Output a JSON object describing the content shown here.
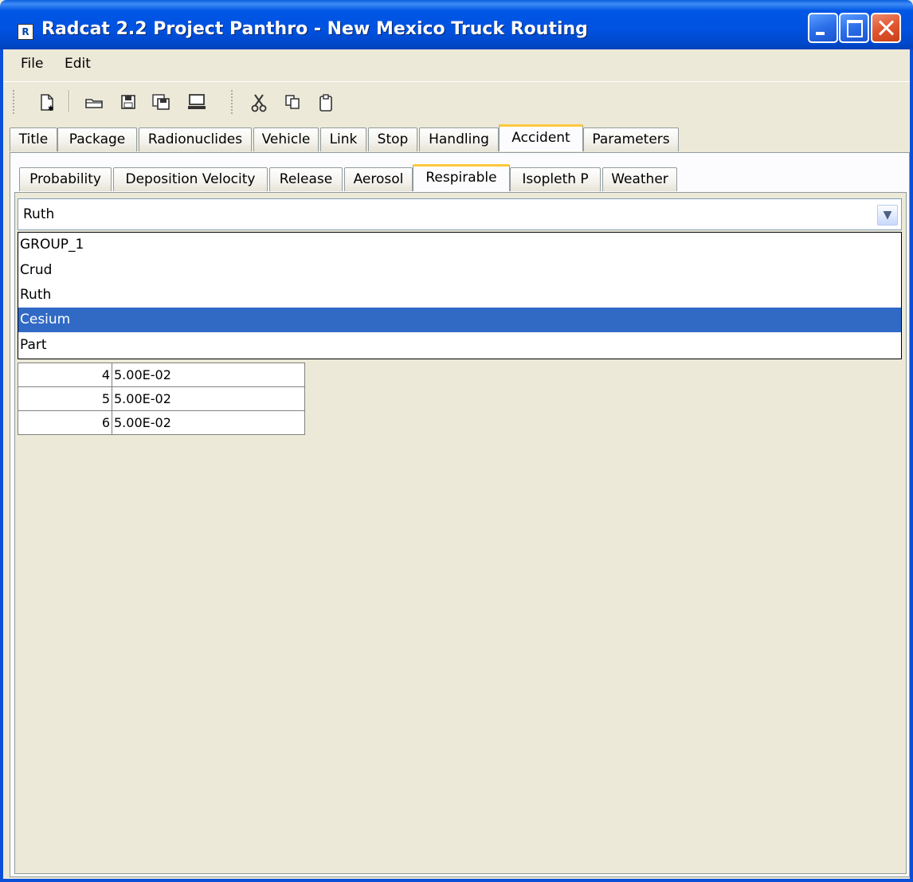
{
  "window": {
    "title": "Radcat 2.2 Project Panthro - New Mexico Truck Routing",
    "icon": "app-icon"
  },
  "menu": [
    "File",
    "Edit"
  ],
  "toolbar": {
    "icons": [
      "new-document-icon",
      "open-folder-icon",
      "save-icon",
      "save-all-icon",
      "run-icon",
      "cut-icon",
      "copy-icon",
      "paste-icon"
    ]
  },
  "main_tabs": [
    "Title",
    "Package",
    "Radionuclides",
    "Vehicle",
    "Link",
    "Stop",
    "Handling",
    "Accident",
    "Parameters"
  ],
  "main_tabs_active": "Accident",
  "sub_tabs": [
    "Probability",
    "Deposition Velocity",
    "Release",
    "Aerosol",
    "Respirable",
    "Isopleth P",
    "Weather"
  ],
  "sub_tabs_active": "Respirable",
  "combo": {
    "value": "Ruth",
    "options": [
      "GROUP_1",
      "Crud",
      "Ruth",
      "Cesium",
      "Part"
    ],
    "highlighted": "Cesium"
  },
  "table": {
    "rows": [
      {
        "index": "4",
        "value": "5.00E-02"
      },
      {
        "index": "5",
        "value": "5.00E-02"
      },
      {
        "index": "6",
        "value": "5.00E-02"
      }
    ]
  },
  "colors": {
    "titlebar": "#0054E3",
    "active_tab_accent": "#FFC83C",
    "selection": "#316AC5",
    "window_bg": "#ECE9D8"
  }
}
